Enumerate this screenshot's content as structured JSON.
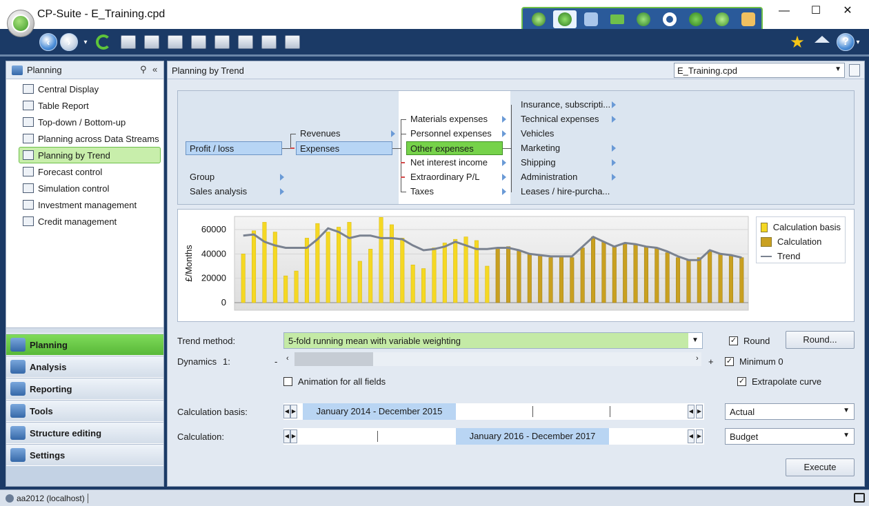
{
  "window": {
    "title": "CP-Suite - E_Training.cpd",
    "min": "—",
    "max": "☐",
    "close": "✕"
  },
  "left_panel": {
    "title": "Planning",
    "items": [
      {
        "label": "Central Display"
      },
      {
        "label": "Table Report"
      },
      {
        "label": "Top-down / Bottom-up"
      },
      {
        "label": "Planning across Data Streams"
      },
      {
        "label": "Planning by Trend",
        "selected": true
      },
      {
        "label": "Forecast control"
      },
      {
        "label": "Simulation control"
      },
      {
        "label": "Investment management"
      },
      {
        "label": "Credit management"
      }
    ],
    "modules": [
      {
        "label": "Planning",
        "active": true
      },
      {
        "label": "Analysis"
      },
      {
        "label": "Reporting"
      },
      {
        "label": "Tools"
      },
      {
        "label": "Structure editing"
      },
      {
        "label": "Settings"
      }
    ]
  },
  "main": {
    "title": "Planning by Trend",
    "file_select": "E_Training.cpd"
  },
  "tree": {
    "col1": {
      "root": "Profit / loss",
      "group": "Group",
      "sales": "Sales analysis"
    },
    "col2": {
      "revenues": "Revenues",
      "expenses": "Expenses"
    },
    "col3": [
      "Materials expenses",
      "Personnel expenses",
      "Other expenses",
      "Net interest income",
      "Extraordinary P/L",
      "Taxes"
    ],
    "col4": [
      "Insurance, subscripti...",
      "Technical expenses",
      "Vehicles",
      "Marketing",
      "Shipping",
      "Administration",
      "Leases / hire-purcha..."
    ]
  },
  "chart_data": {
    "type": "bar",
    "ylabel": "£/Months",
    "ylim": [
      0,
      70000
    ],
    "yticks": [
      "0",
      "20000",
      "40000",
      "60000"
    ],
    "legend_position": "right",
    "series": [
      {
        "name": "Calculation basis",
        "color": "#f5d823",
        "values": [
          40000,
          59000,
          66000,
          58000,
          22000,
          26000,
          53000,
          65000,
          58000,
          62000,
          66000,
          34000,
          44000,
          70000,
          64000,
          53000,
          31000,
          28000,
          45000,
          49000,
          52000,
          54000,
          51000,
          30000
        ]
      },
      {
        "name": "Calculation",
        "color": "#c9a020",
        "values": [
          45000,
          46000,
          43000,
          40000,
          39000,
          37000,
          38000,
          37000,
          45000,
          54000,
          50000,
          46000,
          49000,
          48000,
          46000,
          45000,
          41000,
          37000,
          35000,
          37000,
          43000,
          40000,
          39000,
          37000
        ]
      },
      {
        "name": "Trend",
        "color": "#7a8290",
        "values": [
          55000,
          56000,
          50000,
          47000,
          45000,
          45000,
          45000,
          52000,
          61000,
          58000,
          53000,
          55000,
          55000,
          53000,
          53000,
          52000,
          47000,
          43000,
          44000,
          46000,
          50000,
          47000,
          44000,
          44000,
          45000,
          45000,
          43000,
          40000,
          39000,
          38000,
          38000,
          38000,
          46000,
          54000,
          50000,
          46000,
          49000,
          48000,
          46000,
          45000,
          42000,
          38000,
          35000,
          35000,
          43000,
          40000,
          39000,
          37000
        ]
      }
    ]
  },
  "controls": {
    "trend_method_label": "Trend method:",
    "trend_method_value": "5-fold running mean with variable weighting",
    "round_label": "Round",
    "round_checked": "✓",
    "round_button": "Round...",
    "dynamics_label": "Dynamics",
    "dynamics_value": "1:",
    "minus": "-",
    "plus": "+",
    "minimum_label": "Minimum 0",
    "minimum_checked": "✓",
    "animation_label": "Animation for all fields",
    "extrapolate_label": "Extrapolate curve",
    "extrapolate_checked": "✓",
    "calc_basis_label": "Calculation basis:",
    "calc_basis_range": "January 2014 - December 2015",
    "calc_basis_select": "Actual",
    "calc_label": "Calculation:",
    "calc_range": "January 2016 - December 2017",
    "calc_select": "Budget",
    "execute_button": "Execute"
  },
  "status": {
    "text": "aa2012 (localhost)"
  }
}
